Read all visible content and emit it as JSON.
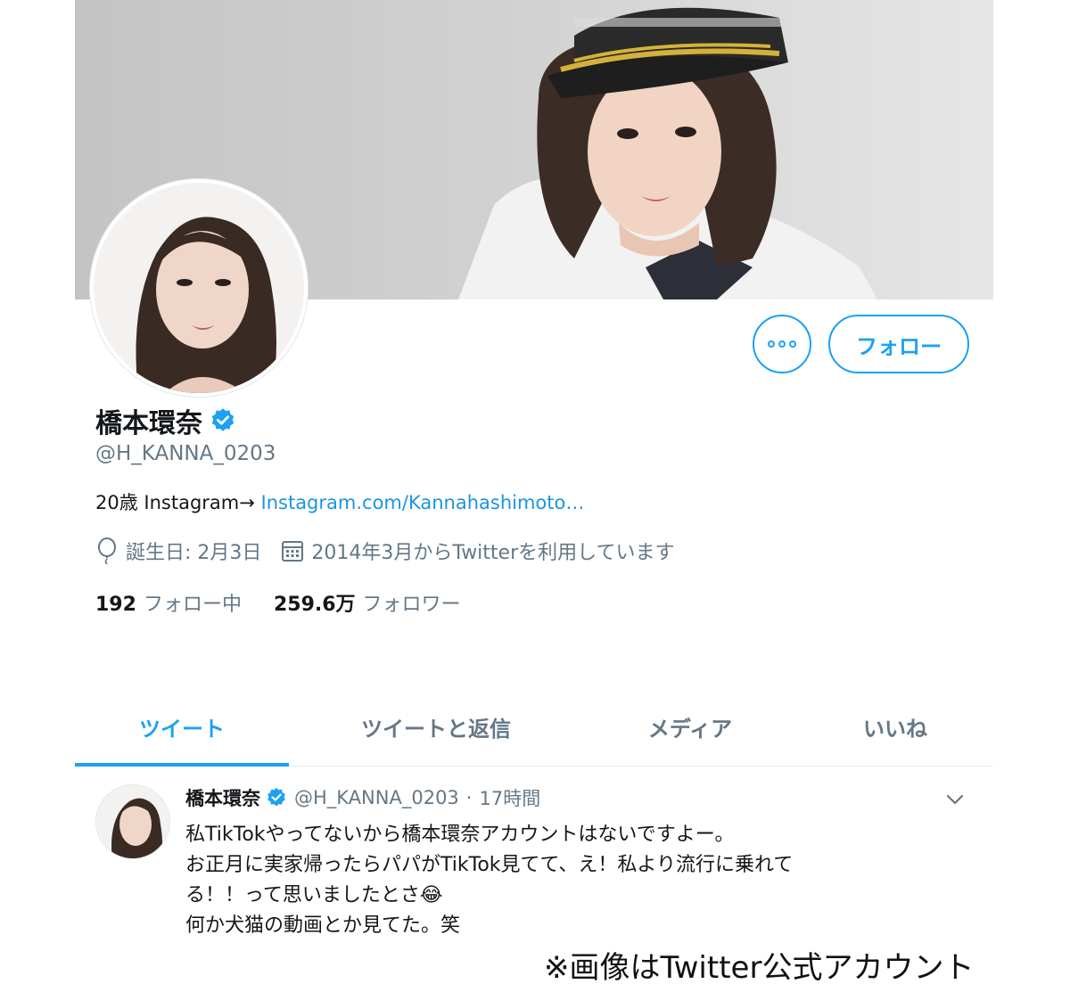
{
  "profile": {
    "display_name": "橋本環奈",
    "handle": "@H_KANNA_0203",
    "bio_text": "20歳 Instagram→ ",
    "bio_link": "Instagram.com/Kannahashimoto…",
    "birthday": "誕生日: 2月3日",
    "joined": "2014年3月からTwitterを利用しています",
    "following_count": "192",
    "following_label": "フォロー中",
    "followers_count": "259.6万",
    "followers_label": "フォロワー"
  },
  "actions": {
    "follow_label": "フォロー"
  },
  "tabs": [
    {
      "label": "ツイート",
      "active": true
    },
    {
      "label": "ツイートと返信",
      "active": false
    },
    {
      "label": "メディア",
      "active": false
    },
    {
      "label": "いいね",
      "active": false
    }
  ],
  "tweet": {
    "name": "橋本環奈",
    "handle": "@H_KANNA_0203",
    "separator": "·",
    "time": "17時間",
    "lines": [
      "私TikTokやってないから橋本環奈アカウントはないですよー。",
      "お正月に実家帰ったらパパがTikTok見てて、え！私より流行に乗れて",
      "る！！って思いましたとさ😂",
      "何か犬猫の動画とか見てた。笑"
    ]
  },
  "caption": "※画像はTwitter公式アカウント",
  "colors": {
    "accent": "#1da1f2",
    "link": "#1b95e0",
    "muted": "#657786",
    "text": "#14171a"
  },
  "icons": [
    "more-icon",
    "verified-icon",
    "birthday-balloon-icon",
    "calendar-icon",
    "chevron-down-icon"
  ]
}
